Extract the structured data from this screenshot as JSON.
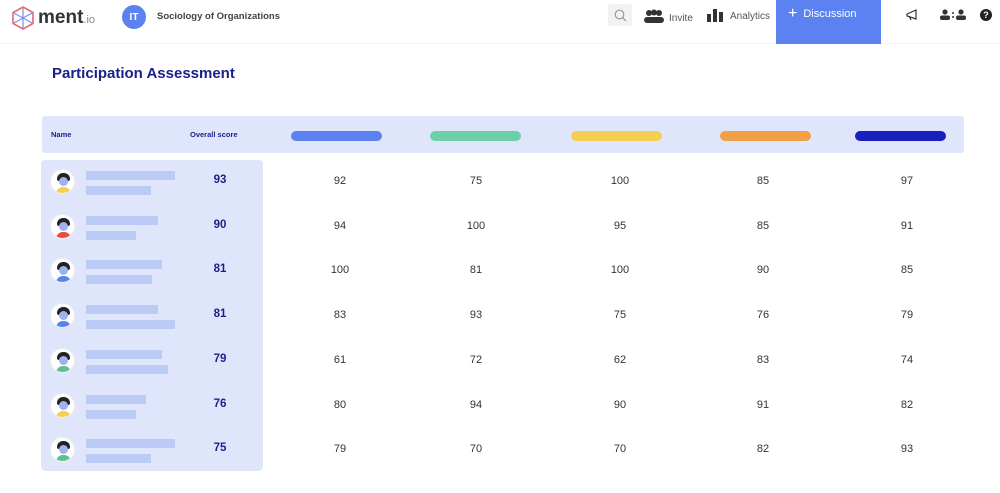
{
  "header": {
    "logo": "ment",
    "logo_suffix": ".io",
    "workspace_initials": "IT",
    "workspace_name": "Sociology of Organizations",
    "nav": [
      {
        "label": "Invite",
        "icon": "users-icon"
      },
      {
        "label": "Analytics",
        "icon": "bar-chart-icon"
      }
    ],
    "discussion_button": "Discussion",
    "icons": [
      "search-icon",
      "megaphone-icon",
      "people-icon",
      "help-icon"
    ],
    "help_glyph": "?"
  },
  "page_title": "Participation Assessment",
  "table": {
    "headers": {
      "name": "Name",
      "overall": "Overall score"
    },
    "category_colors": [
      "#5b82f0",
      "#6ccfa5",
      "#f5cf4f",
      "#f0a045",
      "#1a1fc0"
    ],
    "rows": [
      {
        "overall": "93",
        "scores": [
          "92",
          "75",
          "100",
          "85",
          "97"
        ],
        "shirt": "#f5cf4f"
      },
      {
        "overall": "90",
        "scores": [
          "94",
          "100",
          "95",
          "85",
          "91"
        ],
        "shirt": "#e94b3c"
      },
      {
        "overall": "81",
        "scores": [
          "100",
          "81",
          "100",
          "90",
          "85"
        ],
        "shirt": "#5b82f0"
      },
      {
        "overall": "81",
        "scores": [
          "83",
          "93",
          "75",
          "76",
          "79"
        ],
        "shirt": "#5b82f0"
      },
      {
        "overall": "79",
        "scores": [
          "61",
          "72",
          "62",
          "83",
          "74"
        ],
        "shirt": "#5cc08f"
      },
      {
        "overall": "76",
        "scores": [
          "80",
          "94",
          "90",
          "91",
          "82"
        ],
        "shirt": "#f5cf4f"
      },
      {
        "overall": "75",
        "scores": [
          "79",
          "70",
          "70",
          "82",
          "93"
        ],
        "shirt": "#5cc08f"
      }
    ]
  }
}
